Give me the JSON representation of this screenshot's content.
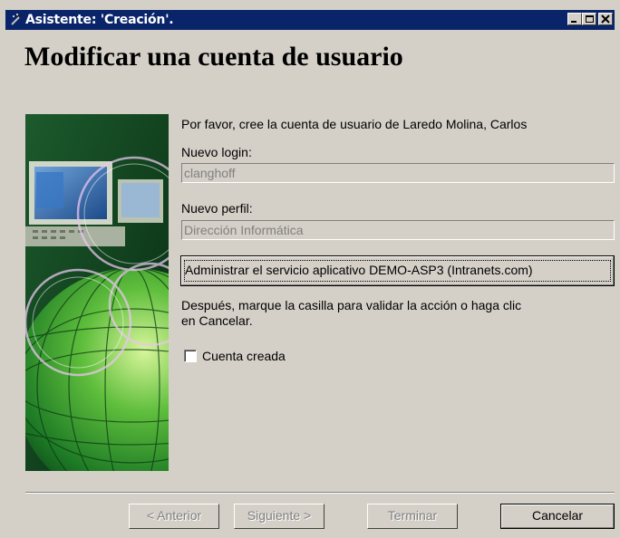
{
  "window": {
    "title": "Asistente: 'Creación'.",
    "icon": "wizard-wand-icon",
    "controls": [
      "minimize-icon",
      "maximize-icon",
      "close-icon"
    ]
  },
  "page_title": "Modificar una cuenta de usuario",
  "illustration": "computer-globe-illustration",
  "intro": "Por favor, cree la cuenta de usuario de Laredo Molina, Carlos",
  "login": {
    "label": "Nuevo login:",
    "value": "clanghoff"
  },
  "profile": {
    "label": "Nuevo perfil:",
    "value": "Dirección Informática"
  },
  "service_button": "Administrar el servicio aplicativo DEMO-ASP3 (Intranets.com)",
  "instructions": {
    "line1": "Después, marque la casilla para validar la acción o haga clic",
    "line2": "en Cancelar."
  },
  "checkbox": {
    "label": "Cuenta creada",
    "checked": false
  },
  "buttons": {
    "back": "< Anterior",
    "next": "Siguiente >",
    "finish": "Terminar",
    "cancel": "Cancelar"
  },
  "colors": {
    "titlebar": "#0a246a",
    "face": "#d4d0c8",
    "disabled_text": "#808080"
  }
}
